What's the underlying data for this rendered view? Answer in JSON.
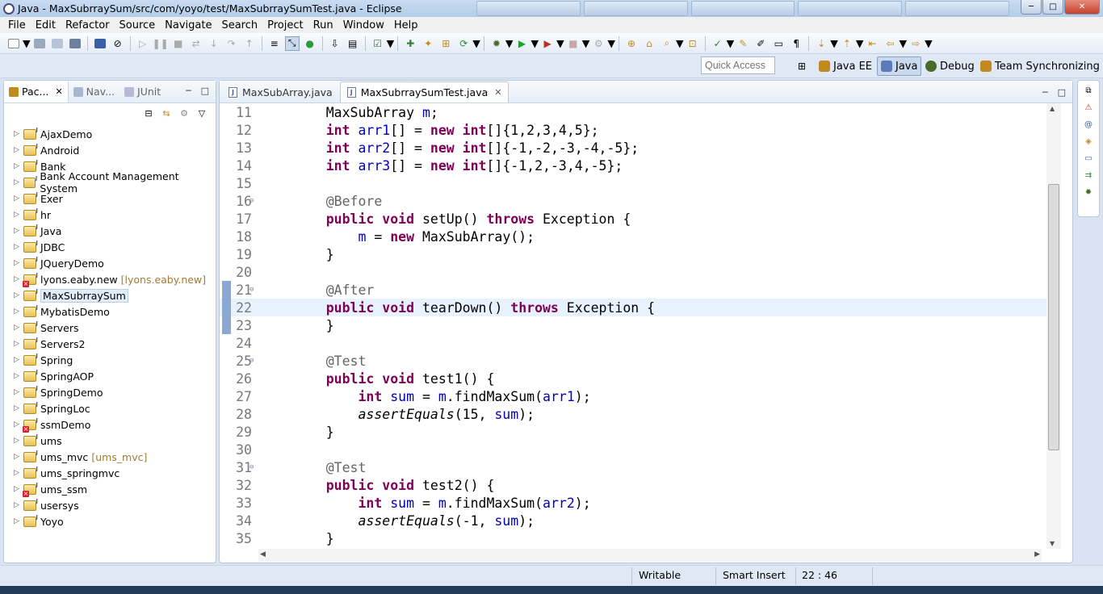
{
  "window": {
    "title": "Java - MaxSubrraySum/src/com/yoyo/test/MaxSubrraySumTest.java - Eclipse",
    "minimize_icon": "minimize-icon",
    "maximize_icon": "maximize-icon",
    "close_icon": "close-icon"
  },
  "menu": [
    "File",
    "Edit",
    "Refactor",
    "Source",
    "Navigate",
    "Search",
    "Project",
    "Run",
    "Window",
    "Help"
  ],
  "quick_access": {
    "placeholder": "Quick Access"
  },
  "perspectives": [
    "Java EE",
    "Java",
    "Debug",
    "Team Synchronizing"
  ],
  "left_view": {
    "tabs": [
      "Pac...",
      "Nav...",
      "JUnit"
    ],
    "projects": [
      {
        "name": "AjaxDemo",
        "error": false,
        "decoration": ""
      },
      {
        "name": "Android",
        "error": false,
        "decoration": ""
      },
      {
        "name": "Bank",
        "error": false,
        "decoration": ""
      },
      {
        "name": "Bank Account Management System",
        "error": false,
        "decoration": ""
      },
      {
        "name": "Exer",
        "error": false,
        "decoration": ""
      },
      {
        "name": "hr",
        "error": false,
        "decoration": ""
      },
      {
        "name": "Java",
        "error": false,
        "decoration": ""
      },
      {
        "name": "JDBC",
        "error": false,
        "decoration": ""
      },
      {
        "name": "JQueryDemo",
        "error": false,
        "decoration": ""
      },
      {
        "name": "lyons.eaby.new",
        "error": true,
        "decoration": "[lyons.eaby.new]"
      },
      {
        "name": "MaxSubrraySum",
        "error": false,
        "decoration": "",
        "selected": true
      },
      {
        "name": "MybatisDemo",
        "error": false,
        "decoration": ""
      },
      {
        "name": "Servers",
        "error": false,
        "decoration": ""
      },
      {
        "name": "Servers2",
        "error": false,
        "decoration": ""
      },
      {
        "name": "Spring",
        "error": false,
        "decoration": ""
      },
      {
        "name": "SpringAOP",
        "error": false,
        "decoration": ""
      },
      {
        "name": "SpringDemo",
        "error": false,
        "decoration": ""
      },
      {
        "name": "SpringLoc",
        "error": false,
        "decoration": ""
      },
      {
        "name": "ssmDemo",
        "error": true,
        "decoration": ""
      },
      {
        "name": "ums",
        "error": false,
        "decoration": ""
      },
      {
        "name": "ums_mvc",
        "error": false,
        "decoration": "[ums_mvc]"
      },
      {
        "name": "ums_springmvc",
        "error": false,
        "decoration": ""
      },
      {
        "name": "ums_ssm",
        "error": true,
        "decoration": ""
      },
      {
        "name": "usersys",
        "error": false,
        "decoration": ""
      },
      {
        "name": "Yoyo",
        "error": false,
        "decoration": ""
      }
    ]
  },
  "editor": {
    "tabs": [
      {
        "label": "MaxSubArray.java",
        "active": false
      },
      {
        "label": "MaxSubrraySumTest.java",
        "active": true
      }
    ],
    "current_line": 22,
    "lines": [
      {
        "n": "11",
        "fold": false,
        "tokens": [
          [
            "",
            "    MaxSubArray "
          ],
          [
            "fld",
            "m"
          ],
          [
            "",
            ";"
          ]
        ]
      },
      {
        "n": "12",
        "fold": false,
        "tokens": [
          [
            "",
            "    "
          ],
          [
            "kw",
            "int"
          ],
          [
            "",
            " "
          ],
          [
            "fld",
            "arr1"
          ],
          [
            "",
            "[] = "
          ],
          [
            "kw",
            "new"
          ],
          [
            "",
            " "
          ],
          [
            "kw",
            "int"
          ],
          [
            "",
            "[]{1,2,3,4,5};"
          ]
        ]
      },
      {
        "n": "13",
        "fold": false,
        "tokens": [
          [
            "",
            "    "
          ],
          [
            "kw",
            "int"
          ],
          [
            "",
            " "
          ],
          [
            "fld",
            "arr2"
          ],
          [
            "",
            "[] = "
          ],
          [
            "kw",
            "new"
          ],
          [
            "",
            " "
          ],
          [
            "kw",
            "int"
          ],
          [
            "",
            "[]{-1,-2,-3,-4,-5};"
          ]
        ]
      },
      {
        "n": "14",
        "fold": false,
        "tokens": [
          [
            "",
            "    "
          ],
          [
            "kw",
            "int"
          ],
          [
            "",
            " "
          ],
          [
            "fld",
            "arr3"
          ],
          [
            "",
            "[] = "
          ],
          [
            "kw",
            "new"
          ],
          [
            "",
            " "
          ],
          [
            "kw",
            "int"
          ],
          [
            "",
            "[]{-1,2,-3,4,-5};"
          ]
        ]
      },
      {
        "n": "15",
        "fold": false,
        "tokens": []
      },
      {
        "n": "16",
        "fold": true,
        "tokens": [
          [
            "",
            "    "
          ],
          [
            "ann",
            "@Before"
          ]
        ]
      },
      {
        "n": "17",
        "fold": false,
        "tokens": [
          [
            "",
            "    "
          ],
          [
            "kw",
            "public"
          ],
          [
            "",
            " "
          ],
          [
            "kw",
            "void"
          ],
          [
            "",
            " setUp() "
          ],
          [
            "kw",
            "throws"
          ],
          [
            "",
            " Exception {"
          ]
        ]
      },
      {
        "n": "18",
        "fold": false,
        "tokens": [
          [
            "",
            "        "
          ],
          [
            "fld",
            "m"
          ],
          [
            "",
            " = "
          ],
          [
            "kw",
            "new"
          ],
          [
            "",
            " MaxSubArray();"
          ]
        ]
      },
      {
        "n": "19",
        "fold": false,
        "tokens": [
          [
            "",
            "    }"
          ]
        ]
      },
      {
        "n": "20",
        "fold": false,
        "tokens": []
      },
      {
        "n": "21",
        "fold": true,
        "tokens": [
          [
            "",
            "    "
          ],
          [
            "ann",
            "@After"
          ]
        ]
      },
      {
        "n": "22",
        "fold": false,
        "tokens": [
          [
            "",
            "    "
          ],
          [
            "kw",
            "public"
          ],
          [
            "",
            " "
          ],
          [
            "kw",
            "void"
          ],
          [
            "",
            " tearDown() "
          ],
          [
            "kw",
            "throws"
          ],
          [
            "",
            " Exception {"
          ]
        ]
      },
      {
        "n": "23",
        "fold": false,
        "tokens": [
          [
            "",
            "    }"
          ]
        ]
      },
      {
        "n": "24",
        "fold": false,
        "tokens": []
      },
      {
        "n": "25",
        "fold": true,
        "tokens": [
          [
            "",
            "    "
          ],
          [
            "ann",
            "@Test"
          ]
        ]
      },
      {
        "n": "26",
        "fold": false,
        "tokens": [
          [
            "",
            "    "
          ],
          [
            "kw",
            "public"
          ],
          [
            "",
            " "
          ],
          [
            "kw",
            "void"
          ],
          [
            "",
            " test1() {"
          ]
        ]
      },
      {
        "n": "27",
        "fold": false,
        "tokens": [
          [
            "",
            "        "
          ],
          [
            "kw",
            "int"
          ],
          [
            "",
            " "
          ],
          [
            "fld",
            "sum"
          ],
          [
            "",
            " = "
          ],
          [
            "fld",
            "m"
          ],
          [
            "",
            ".findMaxSum("
          ],
          [
            "fld",
            "arr1"
          ],
          [
            "",
            ");"
          ]
        ]
      },
      {
        "n": "28",
        "fold": false,
        "tokens": [
          [
            "",
            "        "
          ],
          [
            "it",
            "assertEquals"
          ],
          [
            "",
            "(15, "
          ],
          [
            "fld",
            "sum"
          ],
          [
            "",
            ");"
          ]
        ]
      },
      {
        "n": "29",
        "fold": false,
        "tokens": [
          [
            "",
            "    }"
          ]
        ]
      },
      {
        "n": "30",
        "fold": false,
        "tokens": []
      },
      {
        "n": "31",
        "fold": true,
        "tokens": [
          [
            "",
            "    "
          ],
          [
            "ann",
            "@Test"
          ]
        ]
      },
      {
        "n": "32",
        "fold": false,
        "tokens": [
          [
            "",
            "    "
          ],
          [
            "kw",
            "public"
          ],
          [
            "",
            " "
          ],
          [
            "kw",
            "void"
          ],
          [
            "",
            " test2() {"
          ]
        ]
      },
      {
        "n": "33",
        "fold": false,
        "tokens": [
          [
            "",
            "        "
          ],
          [
            "kw",
            "int"
          ],
          [
            "",
            " "
          ],
          [
            "fld",
            "sum"
          ],
          [
            "",
            " = "
          ],
          [
            "fld",
            "m"
          ],
          [
            "",
            ".findMaxSum("
          ],
          [
            "fld",
            "arr2"
          ],
          [
            "",
            ");"
          ]
        ]
      },
      {
        "n": "34",
        "fold": false,
        "tokens": [
          [
            "",
            "        "
          ],
          [
            "it",
            "assertEquals"
          ],
          [
            "",
            "(-1, "
          ],
          [
            "fld",
            "sum"
          ],
          [
            "",
            ");"
          ]
        ]
      },
      {
        "n": "35",
        "fold": false,
        "tokens": [
          [
            "",
            "    }"
          ]
        ]
      }
    ]
  },
  "status": {
    "writable": "Writable",
    "insert_mode": "Smart Insert",
    "position": "22 : 46"
  },
  "colors": {
    "keyword": "#7f0055",
    "annotation": "#646464",
    "field": "#0000c0",
    "current_line": "#e8f2fe"
  }
}
